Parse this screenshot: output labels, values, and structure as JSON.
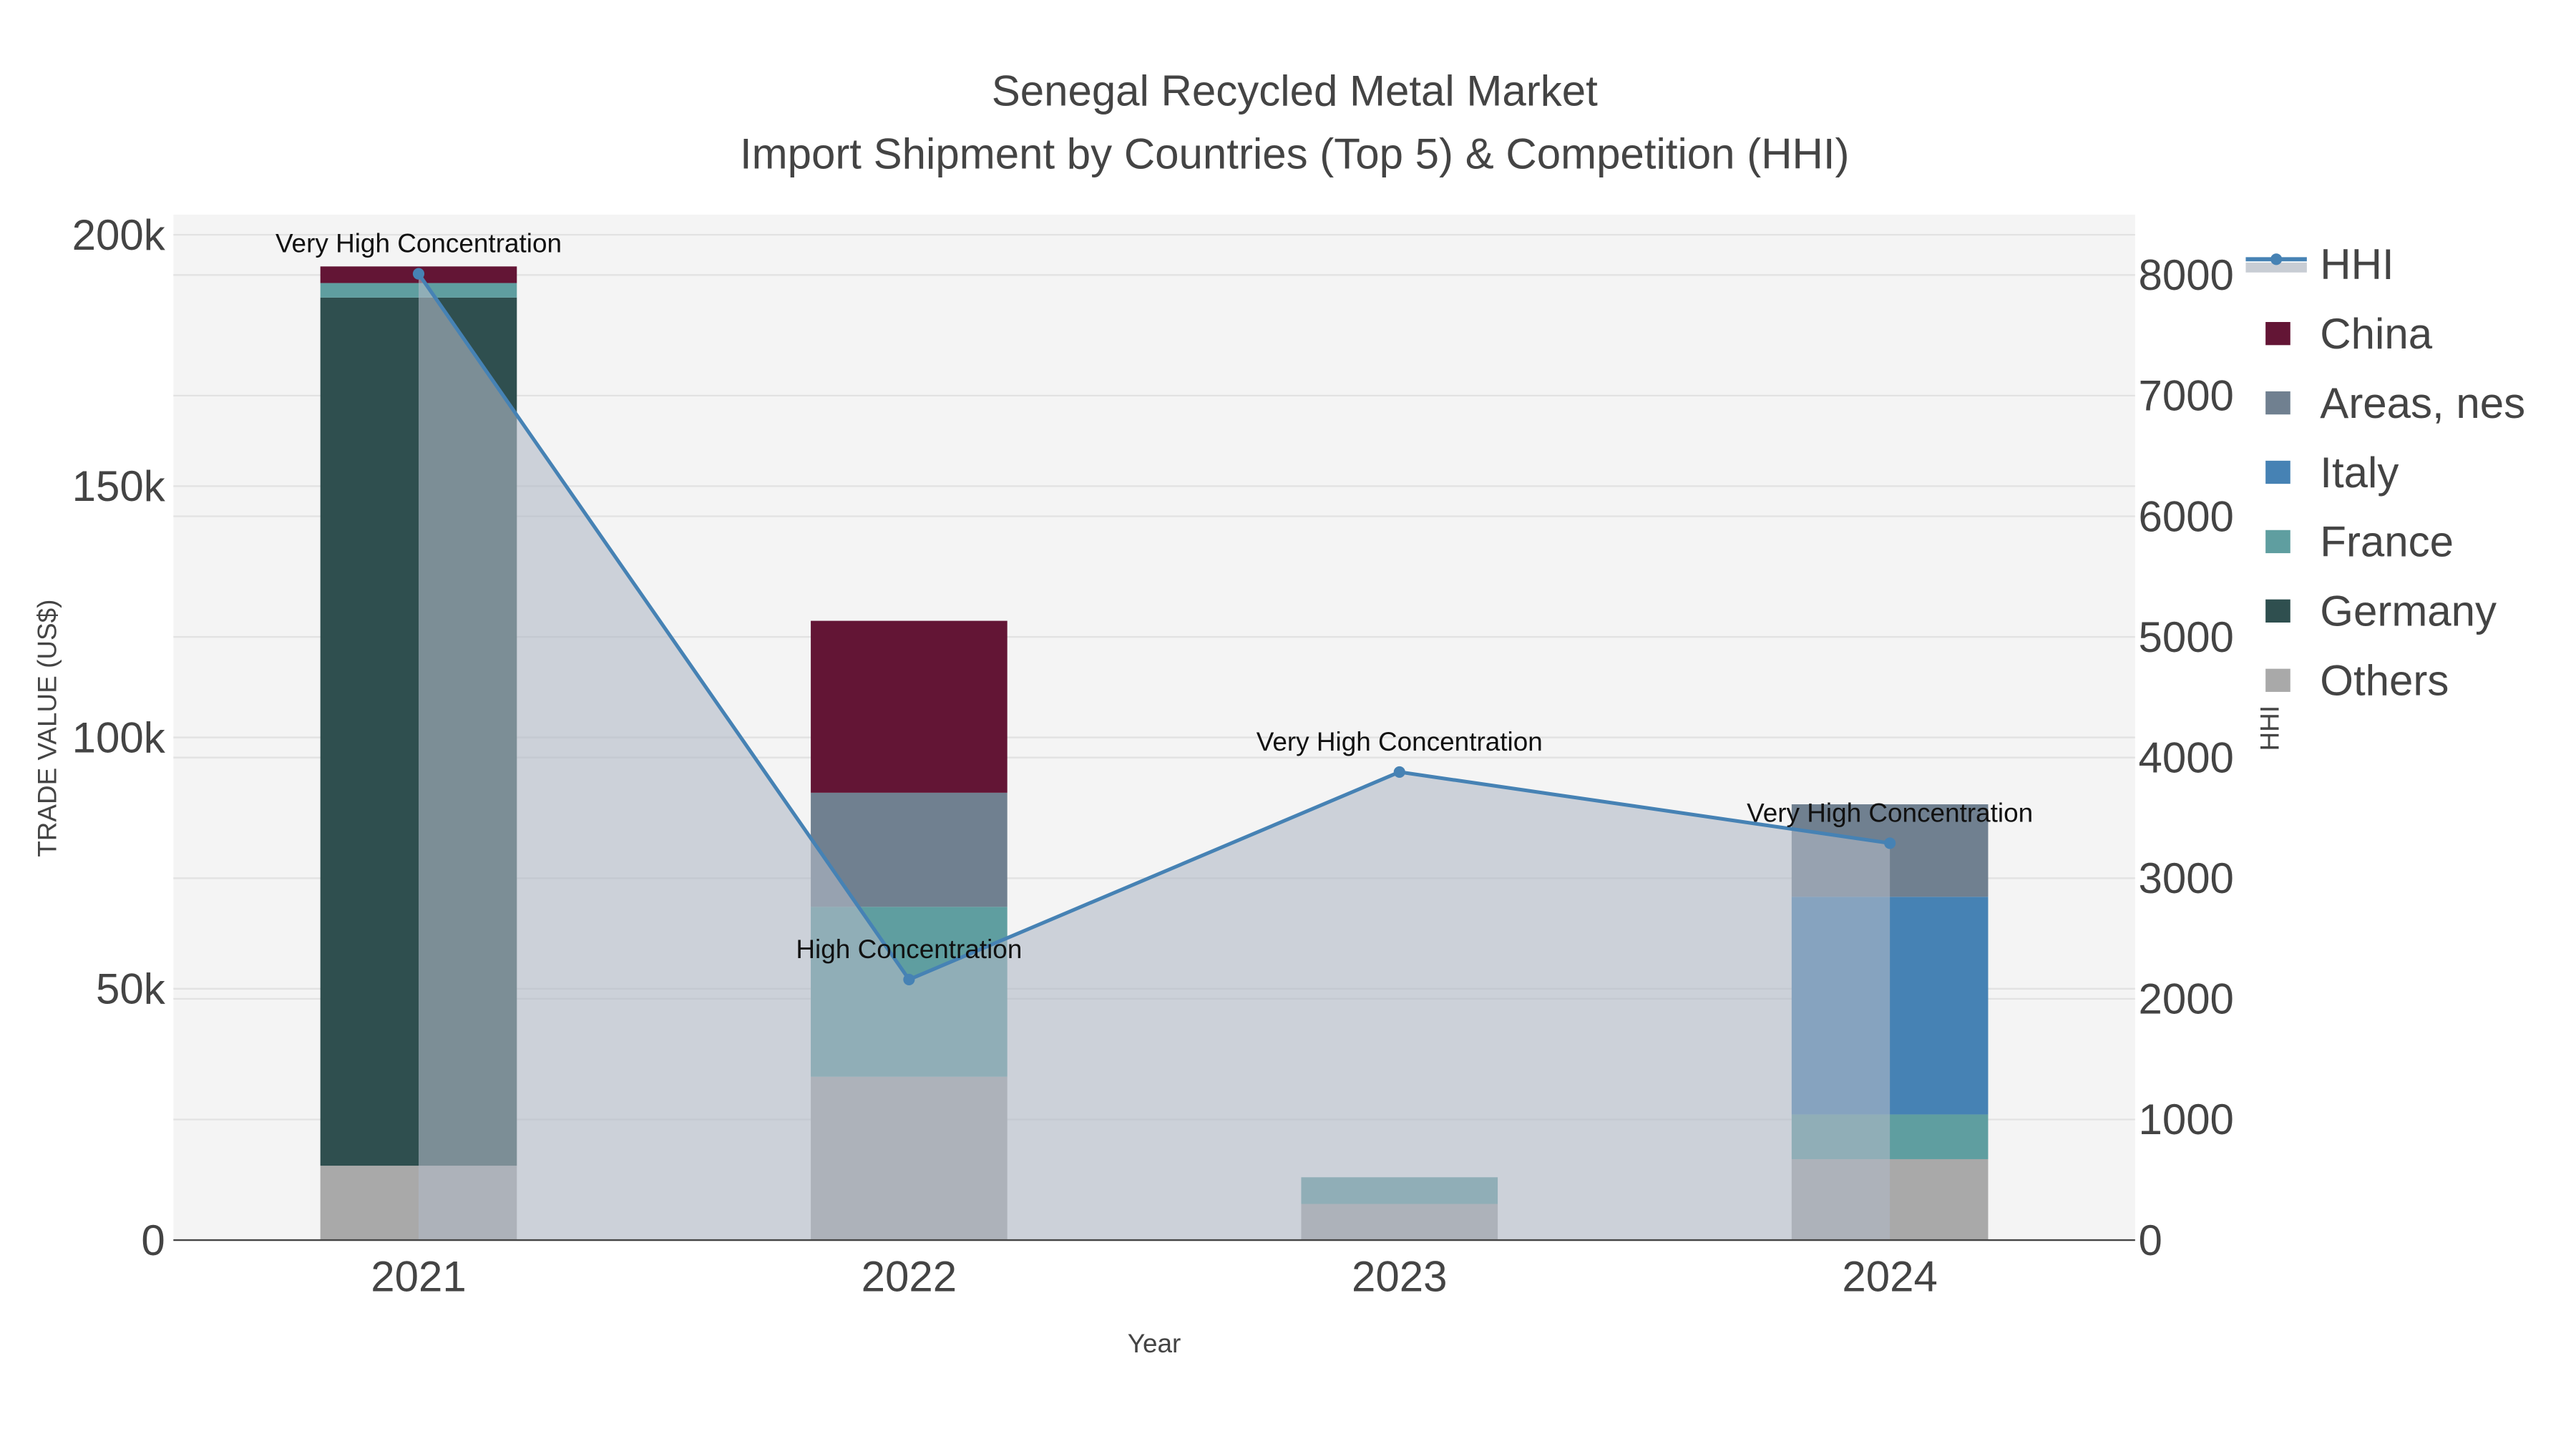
{
  "chart_data": {
    "type": "bar",
    "stacked": true,
    "title_line1": "Senegal Recycled Metal Market",
    "title_line2": "Import Shipment by Countries (Top 5) & Competition (HHI)",
    "xlabel": "Year",
    "ylabel": "TRADE VALUE (US$)",
    "y2label": "HHI",
    "categories": [
      "2021",
      "2022",
      "2023",
      "2024"
    ],
    "ylim": [
      0,
      204000
    ],
    "y2lim": [
      0,
      8500
    ],
    "yticks": [
      {
        "v": 0,
        "label": "0"
      },
      {
        "v": 50000,
        "label": "50k"
      },
      {
        "v": 100000,
        "label": "100k"
      },
      {
        "v": 150000,
        "label": "150k"
      },
      {
        "v": 200000,
        "label": "200k"
      }
    ],
    "y2ticks": [
      {
        "v": 0,
        "label": "0"
      },
      {
        "v": 1000,
        "label": "1000"
      },
      {
        "v": 2000,
        "label": "2000"
      },
      {
        "v": 3000,
        "label": "3000"
      },
      {
        "v": 4000,
        "label": "4000"
      },
      {
        "v": 5000,
        "label": "5000"
      },
      {
        "v": 6000,
        "label": "6000"
      },
      {
        "v": 7000,
        "label": "7000"
      },
      {
        "v": 8000,
        "label": "8000"
      }
    ],
    "grid": true,
    "legend_position": "right",
    "series": [
      {
        "name": "Others",
        "color": "#a9a9a9",
        "values": [
          14800,
          32500,
          7200,
          16100
        ]
      },
      {
        "name": "Germany",
        "color": "#2f4f4f",
        "values": [
          172700,
          0,
          0,
          0
        ]
      },
      {
        "name": "France",
        "color": "#5f9ea0",
        "values": [
          2900,
          33800,
          5300,
          8900
        ]
      },
      {
        "name": "Italy",
        "color": "#4682b4",
        "values": [
          0,
          0,
          0,
          43300
        ]
      },
      {
        "name": "Areas, nes",
        "color": "#708090",
        "values": [
          0,
          22700,
          0,
          18400
        ]
      },
      {
        "name": "China",
        "color": "#631535",
        "values": [
          3300,
          34200,
          0,
          0
        ]
      }
    ],
    "legend_order": [
      "HHI",
      "China",
      "Areas, nes",
      "Italy",
      "France",
      "Germany",
      "Others"
    ],
    "hhi": {
      "name": "HHI",
      "color": "#4682b4",
      "fill": "#b0b9c7",
      "values": [
        8010,
        2160,
        3880,
        3290
      ],
      "annotations": [
        "Very High Concentration",
        "High Concentration",
        "Very High Concentration",
        "Very High Concentration"
      ]
    }
  }
}
